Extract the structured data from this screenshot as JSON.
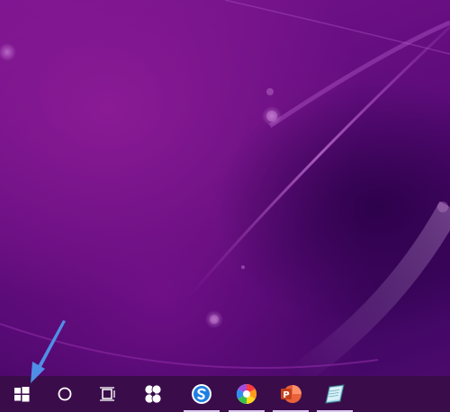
{
  "desktop": {
    "wallpaper": {
      "base_color": "#6a0f82",
      "highlight_color": "#b23fc8",
      "dark_color": "#3e0560"
    }
  },
  "taskbar": {
    "background_color": "#3a0d4a",
    "indicator_color": "#d9c6f0",
    "items": [
      {
        "icon": "windows-start-icon",
        "running": false
      },
      {
        "icon": "search-circle-icon",
        "running": false
      },
      {
        "icon": "task-view-icon",
        "running": false
      },
      {
        "icon": "flower-app-icon",
        "running": false
      },
      {
        "icon": "sogou-browser-icon",
        "running": true
      },
      {
        "icon": "colorful-orb-app-icon",
        "running": true
      },
      {
        "icon": "powerpoint-icon",
        "running": true
      },
      {
        "icon": "notepad-app-icon",
        "running": true
      }
    ]
  },
  "annotation": {
    "arrow_color": "#4f8fe8",
    "points_to": "windows-start-icon"
  }
}
